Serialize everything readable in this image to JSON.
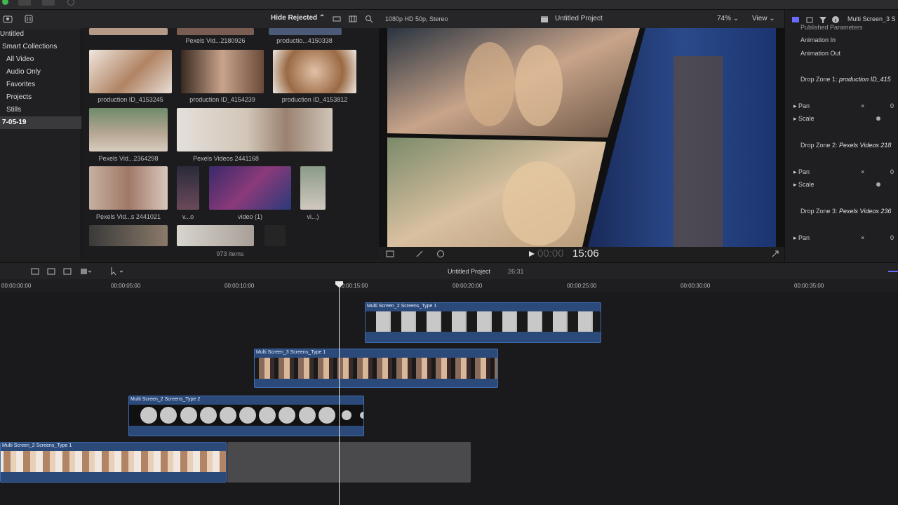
{
  "library": {
    "title": "Untitled",
    "items": [
      {
        "label": "Smart Collections"
      },
      {
        "label": "All Video"
      },
      {
        "label": "Audio Only"
      },
      {
        "label": "Favorites"
      },
      {
        "label": "Projects"
      },
      {
        "label": "Stills"
      },
      {
        "label": "7-05-19"
      }
    ]
  },
  "browser": {
    "filter": "Hide Rejected",
    "item_count": "973 items",
    "top_captions": [
      "Pexels Vid...2180926",
      "productio...4150338"
    ],
    "captions": [
      "production ID_4153245",
      "production ID_4154239",
      "production ID_4153812",
      "Pexels Vid...2364298",
      "Pexels Videos 2441168",
      "Pexels Vid...s 2441021",
      "v...o",
      "video (1)",
      "vi...)"
    ]
  },
  "viewer": {
    "format": "1080p HD 50p, Stereo",
    "project": "Untitled Project",
    "zoom": "74%",
    "view_label": "View",
    "timecode_dim": "00:00",
    "timecode": "15:06"
  },
  "inspector": {
    "title": "Multi Screen_3 S",
    "section": "Published Parameters",
    "anim_in": "Animation In",
    "anim_out": "Animation Out",
    "zones": [
      {
        "label": "Drop Zone 1:",
        "value": "production ID_415"
      },
      {
        "label": "Drop Zone 2:",
        "value": "Pexels Videos 218"
      },
      {
        "label": "Drop Zone 3:",
        "value": "Pexels Videos 236"
      }
    ],
    "pan": "Pan",
    "scale": "Scale",
    "pan_value": "0"
  },
  "timeline": {
    "project": "Untitled Project",
    "duration": "26:31",
    "ruler": [
      "00:00:00:00",
      "00:00:05:00",
      "00:00:10:00",
      "00:00:15:00",
      "00:00:20:00",
      "00:00:25:00",
      "00:00:30:00",
      "00:00:35:00"
    ],
    "clips": [
      {
        "name": "Multi Screen_2 Screens_Type 1"
      },
      {
        "name": "Multi Screen_3 Screens_Type 1"
      },
      {
        "name": "Multi Screen_2 Screens_Type 2"
      },
      {
        "name": "Multi Screen_2 Screens_Type 1"
      }
    ]
  },
  "colors": {
    "clip_blue": "#2b4a7a",
    "accent": "#6a6aff"
  }
}
